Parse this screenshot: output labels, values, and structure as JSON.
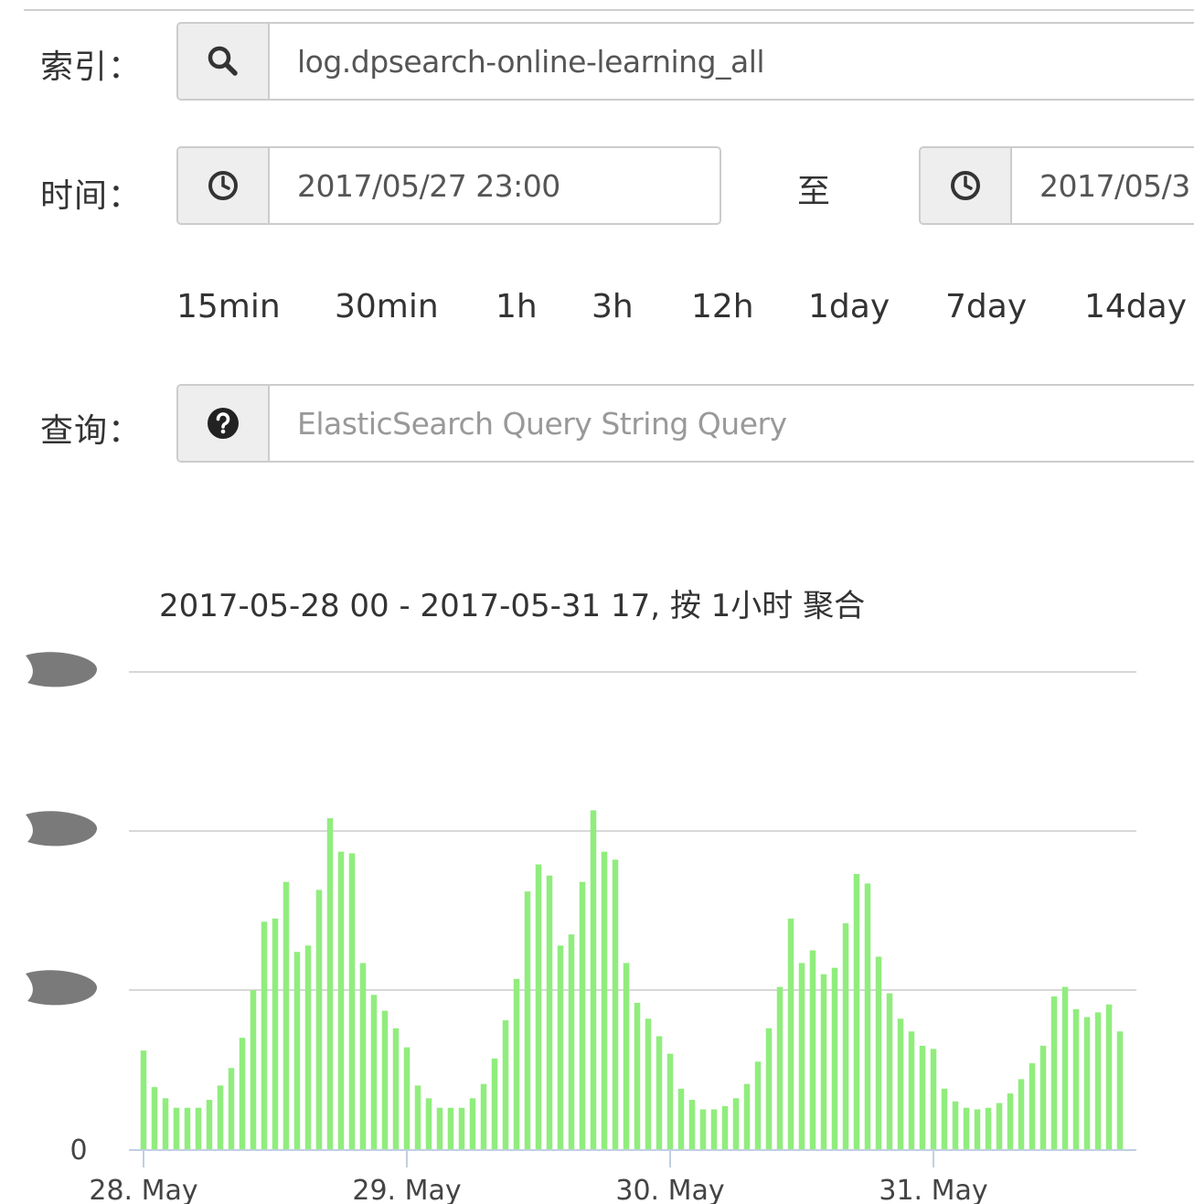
{
  "index": {
    "label": "索引：",
    "icon": "search-icon",
    "value": "log.dpsearch-online-learning_all"
  },
  "time": {
    "label": "时间：",
    "icon": "clock-icon",
    "start": "2017/05/27 23:00",
    "separator": "至",
    "end": "2017/05/3"
  },
  "quick_ranges": [
    "15min",
    "30min",
    "1h",
    "3h",
    "12h",
    "1day",
    "7day",
    "14day"
  ],
  "query": {
    "label": "查询：",
    "icon": "question-circle-icon",
    "placeholder": "ElasticSearch Query String Query"
  },
  "colors": {
    "bar": "#90ed7d",
    "gridline": "#d8d8d8",
    "addon_bg": "#eeeeee",
    "border": "#cccccc",
    "redaction": "#7a7a7a"
  },
  "chart_data": {
    "type": "bar",
    "title": "2017-05-28 00 - 2017-05-31 17, 按 1小时 聚合",
    "x_start": "2017-05-28 00:00",
    "x_interval": "1h",
    "x_ticks": [
      "28. May",
      "29. May",
      "30. May",
      "31. May"
    ],
    "x_tick_indices": [
      0,
      24,
      48,
      72
    ],
    "y_ticks": [
      "0"
    ],
    "y_tick_values": [
      0
    ],
    "y_labels_obscured": true,
    "ylim": [
      0,
      4
    ],
    "grid": true,
    "values": [
      0.62,
      0.39,
      0.32,
      0.26,
      0.26,
      0.26,
      0.31,
      0.4,
      0.51,
      0.7,
      1.0,
      1.43,
      1.45,
      1.68,
      1.24,
      1.28,
      1.63,
      2.08,
      1.87,
      1.86,
      1.17,
      0.97,
      0.87,
      0.76,
      0.64,
      0.4,
      0.32,
      0.26,
      0.26,
      0.26,
      0.32,
      0.41,
      0.57,
      0.81,
      1.07,
      1.62,
      1.79,
      1.72,
      1.28,
      1.35,
      1.68,
      2.13,
      1.87,
      1.82,
      1.17,
      0.92,
      0.82,
      0.71,
      0.6,
      0.38,
      0.31,
      0.25,
      0.25,
      0.27,
      0.32,
      0.41,
      0.55,
      0.76,
      1.02,
      1.45,
      1.17,
      1.25,
      1.1,
      1.14,
      1.42,
      1.73,
      1.67,
      1.21,
      0.98,
      0.82,
      0.74,
      0.65,
      0.63,
      0.38,
      0.3,
      0.26,
      0.25,
      0.26,
      0.29,
      0.35,
      0.44,
      0.54,
      0.65,
      0.96,
      1.02,
      0.88,
      0.83,
      0.86,
      0.91,
      0.74
    ]
  }
}
